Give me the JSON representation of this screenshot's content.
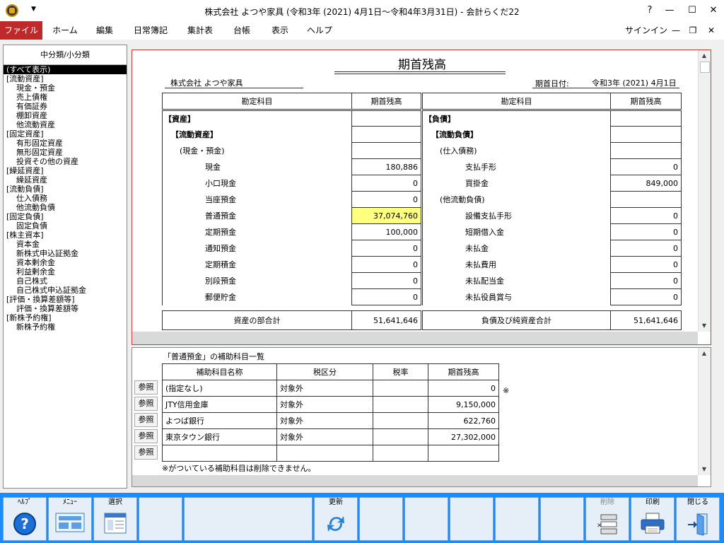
{
  "window": {
    "title": "株式会社 よつや家具 (令和3年 (2021) 4月1日～令和4年3月31日) - 会計らくだ22",
    "controls": {
      "help": "?",
      "minimize": "—",
      "maximize": "☐",
      "close": "✕"
    }
  },
  "menu": {
    "items": [
      "ファイル",
      "ホーム",
      "編集",
      "日常簿記",
      "集計表",
      "台帳",
      "表示",
      "ヘルプ"
    ],
    "signin": "サインイン"
  },
  "sidebar": {
    "header": "中分類/小分類",
    "items": [
      {
        "label": "(すべて表示)",
        "level": 0,
        "selected": true
      },
      {
        "label": "[流動資産]",
        "level": 0
      },
      {
        "label": "現金・預金",
        "level": 1
      },
      {
        "label": "売上債権",
        "level": 1
      },
      {
        "label": "有価証券",
        "level": 1
      },
      {
        "label": "棚卸資産",
        "level": 1
      },
      {
        "label": "他流動資産",
        "level": 1
      },
      {
        "label": "[固定資産]",
        "level": 0
      },
      {
        "label": "有形固定資産",
        "level": 1
      },
      {
        "label": "無形固定資産",
        "level": 1
      },
      {
        "label": "投資その他の資産",
        "level": 1
      },
      {
        "label": "[繰延資産]",
        "level": 0
      },
      {
        "label": "繰延資産",
        "level": 1
      },
      {
        "label": "[流動負債]",
        "level": 0
      },
      {
        "label": "仕入債務",
        "level": 1
      },
      {
        "label": "他流動負債",
        "level": 1
      },
      {
        "label": "[固定負債]",
        "level": 0
      },
      {
        "label": "固定負債",
        "level": 1
      },
      {
        "label": "[株主資本]",
        "level": 0
      },
      {
        "label": "資本金",
        "level": 1
      },
      {
        "label": "新株式申込証拠金",
        "level": 1
      },
      {
        "label": "資本剰余金",
        "level": 1
      },
      {
        "label": "利益剰余金",
        "level": 1
      },
      {
        "label": "自己株式",
        "level": 1
      },
      {
        "label": "自己株式申込証拠金",
        "level": 1
      },
      {
        "label": "[評価・換算差額等]",
        "level": 0
      },
      {
        "label": "評価・換算差額等",
        "level": 1
      },
      {
        "label": "[新株予約権]",
        "level": 0
      },
      {
        "label": "新株予約権",
        "level": 1
      }
    ]
  },
  "report": {
    "title": "期首残高",
    "company": "株式会社 よつや家具",
    "date_label": "期首日付:",
    "date_value": "令和3年 (2021) 4月1日",
    "col_account": "勘定科目",
    "col_balance": "期首残高",
    "left_rows": [
      {
        "label": "【資産】",
        "amount": "",
        "ind": 0
      },
      {
        "label": "【流動資産】",
        "amount": "",
        "ind": 1
      },
      {
        "label": "(現金・預金)",
        "amount": "",
        "ind": 2
      },
      {
        "label": "現金",
        "amount": "180,886",
        "ind": 3
      },
      {
        "label": "小口現金",
        "amount": "0",
        "ind": 3
      },
      {
        "label": "当座預金",
        "amount": "0",
        "ind": 3
      },
      {
        "label": "普通預金",
        "amount": "37,074,760",
        "ind": 3,
        "highlight": true
      },
      {
        "label": "定期預金",
        "amount": "100,000",
        "ind": 3
      },
      {
        "label": "通知預金",
        "amount": "0",
        "ind": 3
      },
      {
        "label": "定期積金",
        "amount": "0",
        "ind": 3
      },
      {
        "label": "別段預金",
        "amount": "0",
        "ind": 3
      },
      {
        "label": "郵便貯金",
        "amount": "0",
        "ind": 3
      }
    ],
    "right_rows": [
      {
        "label": "【負債】",
        "amount": "",
        "ind": 0
      },
      {
        "label": "【流動負債】",
        "amount": "",
        "ind": 1
      },
      {
        "label": "(仕入債務)",
        "amount": "",
        "ind": 2
      },
      {
        "label": "支払手形",
        "amount": "0",
        "ind": 3
      },
      {
        "label": "買掛金",
        "amount": "849,000",
        "ind": 3
      },
      {
        "label": "(他流動負債)",
        "amount": "",
        "ind": 2
      },
      {
        "label": "設備支払手形",
        "amount": "0",
        "ind": 3
      },
      {
        "label": "短期借入金",
        "amount": "0",
        "ind": 3
      },
      {
        "label": "未払金",
        "amount": "0",
        "ind": 3
      },
      {
        "label": "未払費用",
        "amount": "0",
        "ind": 3
      },
      {
        "label": "未払配当金",
        "amount": "0",
        "ind": 3
      },
      {
        "label": "未払役員賞与",
        "amount": "0",
        "ind": 3
      }
    ],
    "total_left_label": "資産の部合計",
    "total_left_value": "51,641,646",
    "total_right_label": "負債及び純資産合計",
    "total_right_value": "51,641,646"
  },
  "subaccounts": {
    "title": "「普通預金」の補助科目一覧",
    "headers": [
      "補助科目名称",
      "税区分",
      "税率",
      "期首残高"
    ],
    "rows": [
      {
        "name": "(指定なし)",
        "tax": "対象外",
        "rate": "",
        "amount": "0"
      },
      {
        "name": "JTY信用金庫",
        "tax": "対象外",
        "rate": "",
        "amount": "9,150,000"
      },
      {
        "name": "よつば銀行",
        "tax": "対象外",
        "rate": "",
        "amount": "622,760"
      },
      {
        "name": "東京タウン銀行",
        "tax": "対象外",
        "rate": "",
        "amount": "27,302,000"
      },
      {
        "name": "",
        "tax": "",
        "rate": "",
        "amount": ""
      }
    ],
    "ref_label": "参照",
    "star": "※",
    "footnote": "※がついている補助科目は削除できません。"
  },
  "toolbar": {
    "help": "ﾍﾙﾌﾟ",
    "menu": "ﾒﾆｭｰ",
    "select": "選択",
    "refresh": "更新",
    "delete": "削除",
    "print": "印刷",
    "close": "閉じる"
  },
  "colors": {
    "accent": "#c02929",
    "toolbar": "#1a8cff",
    "highlight": "#ffff80"
  }
}
